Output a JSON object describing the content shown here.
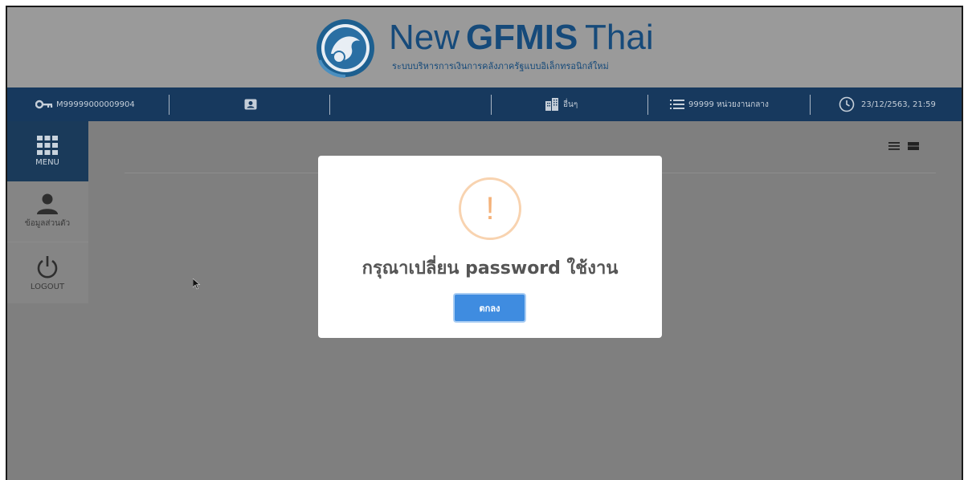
{
  "logo": {
    "word_new": "New",
    "word_gfmis": "GFMIS",
    "word_thai": "Thai",
    "subtitle": "ระบบบริหารการเงินการคลังภาครัฐแบบอิเล็กทรอนิกส์ใหม่"
  },
  "infobar": {
    "user_id": "M99999000009904",
    "org_label": "อื่นๆ",
    "department": "99999 หน่วยงานกลาง",
    "datetime": "23/12/2563, 21:59"
  },
  "sidebar": {
    "items": [
      {
        "label": "MENU",
        "icon": "grid-icon"
      },
      {
        "label": "ข้อมูลส่วนตัว",
        "icon": "user-icon"
      },
      {
        "label": "LOGOUT",
        "icon": "power-icon"
      }
    ]
  },
  "dialog": {
    "message": "กรุณาเปลี่ยน password ใช้งาน",
    "icon_glyph": "!",
    "ok_label": "ตกลง"
  },
  "colors": {
    "brand_navy": "#17395e",
    "logo_blue": "#164a7a",
    "button_blue": "#3f8ce0",
    "warning_orange": "#f4b27a"
  }
}
